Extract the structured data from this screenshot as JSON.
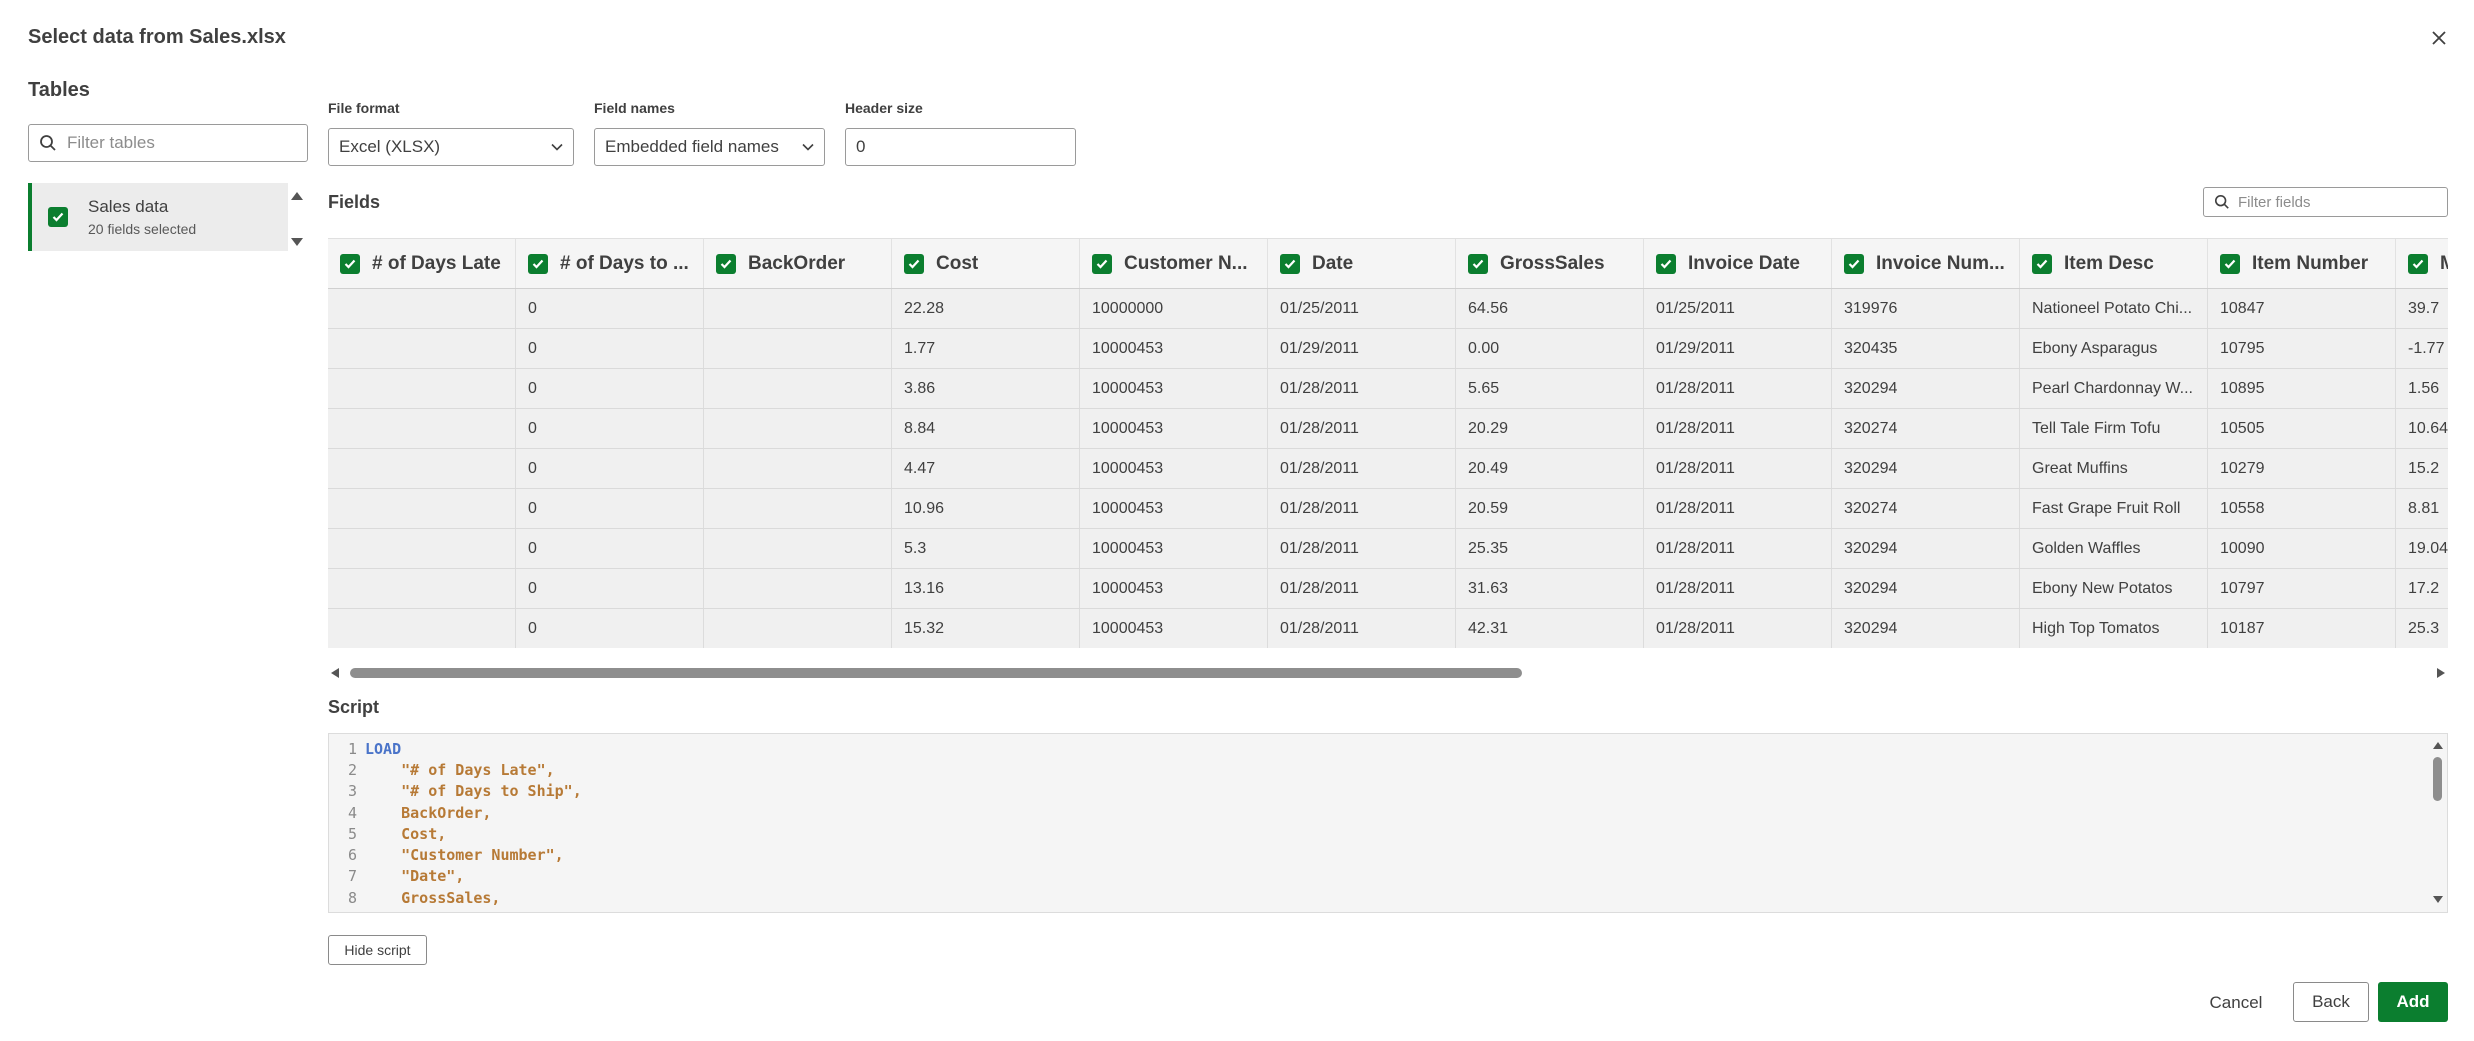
{
  "dialog": {
    "title": "Select data from Sales.xlsx"
  },
  "tables_panel": {
    "heading": "Tables",
    "filter_placeholder": "Filter tables",
    "items": [
      {
        "name": "Sales data",
        "subtitle": "20 fields selected",
        "checked": true
      }
    ]
  },
  "options": {
    "file_format": {
      "label": "File format",
      "value": "Excel (XLSX)"
    },
    "field_names": {
      "label": "Field names",
      "value": "Embedded field names"
    },
    "header_size": {
      "label": "Header size",
      "value": "0"
    }
  },
  "fields": {
    "heading": "Fields",
    "filter_placeholder": "Filter fields",
    "columns": [
      "# of Days Late",
      "# of Days to ...",
      "BackOrder",
      "Cost",
      "Customer N...",
      "Date",
      "GrossSales",
      "Invoice Date",
      "Invoice Num...",
      "Item Desc",
      "Item Number",
      "M"
    ],
    "rows": [
      [
        "",
        "0",
        "",
        "22.28",
        "10000000",
        "01/25/2011",
        "64.56",
        "01/25/2011",
        "319976",
        "Nationeel Potato Chi...",
        "10847",
        "39.7"
      ],
      [
        "",
        "0",
        "",
        "1.77",
        "10000453",
        "01/29/2011",
        "0.00",
        "01/29/2011",
        "320435",
        "Ebony Asparagus",
        "10795",
        "-1.77"
      ],
      [
        "",
        "0",
        "",
        "3.86",
        "10000453",
        "01/28/2011",
        "5.65",
        "01/28/2011",
        "320294",
        "Pearl Chardonnay W...",
        "10895",
        "1.56"
      ],
      [
        "",
        "0",
        "",
        "8.84",
        "10000453",
        "01/28/2011",
        "20.29",
        "01/28/2011",
        "320274",
        "Tell Tale Firm Tofu",
        "10505",
        "10.64"
      ],
      [
        "",
        "0",
        "",
        "4.47",
        "10000453",
        "01/28/2011",
        "20.49",
        "01/28/2011",
        "320294",
        "Great Muffins",
        "10279",
        "15.2"
      ],
      [
        "",
        "0",
        "",
        "10.96",
        "10000453",
        "01/28/2011",
        "20.59",
        "01/28/2011",
        "320274",
        "Fast Grape Fruit Roll",
        "10558",
        "8.81"
      ],
      [
        "",
        "0",
        "",
        "5.3",
        "10000453",
        "01/28/2011",
        "25.35",
        "01/28/2011",
        "320294",
        "Golden Waffles",
        "10090",
        "19.04"
      ],
      [
        "",
        "0",
        "",
        "13.16",
        "10000453",
        "01/28/2011",
        "31.63",
        "01/28/2011",
        "320294",
        "Ebony New Potatos",
        "10797",
        "17.2"
      ],
      [
        "",
        "0",
        "",
        "15.32",
        "10000453",
        "01/28/2011",
        "42.31",
        "01/28/2011",
        "320294",
        "High Top Tomatos",
        "10187",
        "25.3"
      ]
    ]
  },
  "script": {
    "heading": "Script",
    "lines": [
      {
        "num": "1",
        "text": "LOAD",
        "kind": "keyword"
      },
      {
        "num": "2",
        "text": "    \"# of Days Late\",",
        "kind": "field"
      },
      {
        "num": "3",
        "text": "    \"# of Days to Ship\",",
        "kind": "field"
      },
      {
        "num": "4",
        "text": "    BackOrder,",
        "kind": "field"
      },
      {
        "num": "5",
        "text": "    Cost,",
        "kind": "field"
      },
      {
        "num": "6",
        "text": "    \"Customer Number\",",
        "kind": "field"
      },
      {
        "num": "7",
        "text": "    \"Date\",",
        "kind": "field"
      },
      {
        "num": "8",
        "text": "    GrossSales,",
        "kind": "field"
      }
    ]
  },
  "buttons": {
    "hide_script": "Hide script",
    "cancel": "Cancel",
    "back": "Back",
    "add": "Add"
  },
  "colors": {
    "accent_green": "#0b7e2f",
    "keyword_blue": "#4a74c9",
    "field_orange": "#b77a36"
  }
}
